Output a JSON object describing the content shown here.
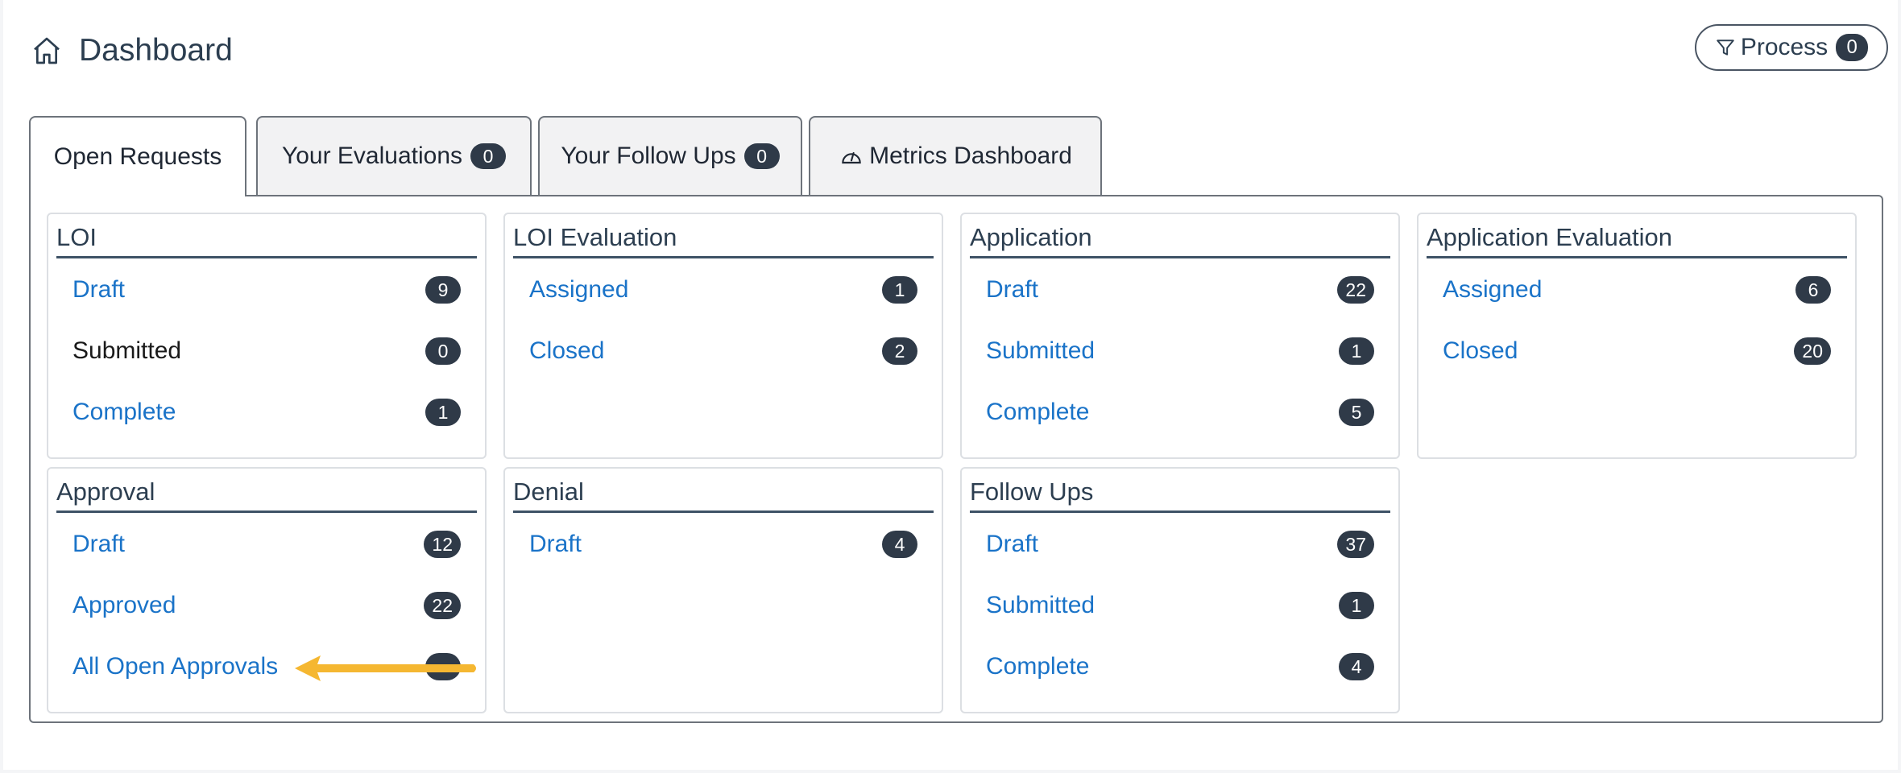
{
  "header": {
    "title": "Dashboard",
    "home_icon": "home-icon",
    "process": {
      "label": "Process",
      "count": "0",
      "icon": "filter-icon"
    }
  },
  "tabs": [
    {
      "label": "Open Requests",
      "active": true
    },
    {
      "label": "Your Evaluations",
      "count": "0"
    },
    {
      "label": "Your Follow Ups",
      "count": "0"
    },
    {
      "label": "Metrics Dashboard",
      "icon": "gauge-icon"
    }
  ],
  "cards": {
    "loi": {
      "title": "LOI",
      "rows": [
        {
          "label": "Draft",
          "count": "9"
        },
        {
          "label": "Submitted",
          "count": "0"
        },
        {
          "label": "Complete",
          "count": "1"
        }
      ]
    },
    "loi_evaluation": {
      "title": "LOI Evaluation",
      "rows": [
        {
          "label": "Assigned",
          "count": "1"
        },
        {
          "label": "Closed",
          "count": "2"
        }
      ]
    },
    "application": {
      "title": "Application",
      "rows": [
        {
          "label": "Draft",
          "count": "22"
        },
        {
          "label": "Submitted",
          "count": "1"
        },
        {
          "label": "Complete",
          "count": "5"
        }
      ]
    },
    "application_evaluation": {
      "title": "Application Evaluation",
      "rows": [
        {
          "label": "Assigned",
          "count": "6"
        },
        {
          "label": "Closed",
          "count": "20"
        }
      ]
    },
    "approval": {
      "title": "Approval",
      "rows": [
        {
          "label": "Draft",
          "count": "12"
        },
        {
          "label": "Approved",
          "count": "22"
        },
        {
          "label": "All Open Approvals",
          "count": ""
        }
      ]
    },
    "denial": {
      "title": "Denial",
      "rows": [
        {
          "label": "Draft",
          "count": "4"
        }
      ]
    },
    "follow_ups": {
      "title": "Follow Ups",
      "rows": [
        {
          "label": "Draft",
          "count": "37"
        },
        {
          "label": "Submitted",
          "count": "1"
        },
        {
          "label": "Complete",
          "count": "4"
        }
      ]
    }
  },
  "colors": {
    "link": "#1a73c8",
    "badge": "#2f3a48",
    "arrow": "#f5b731"
  }
}
